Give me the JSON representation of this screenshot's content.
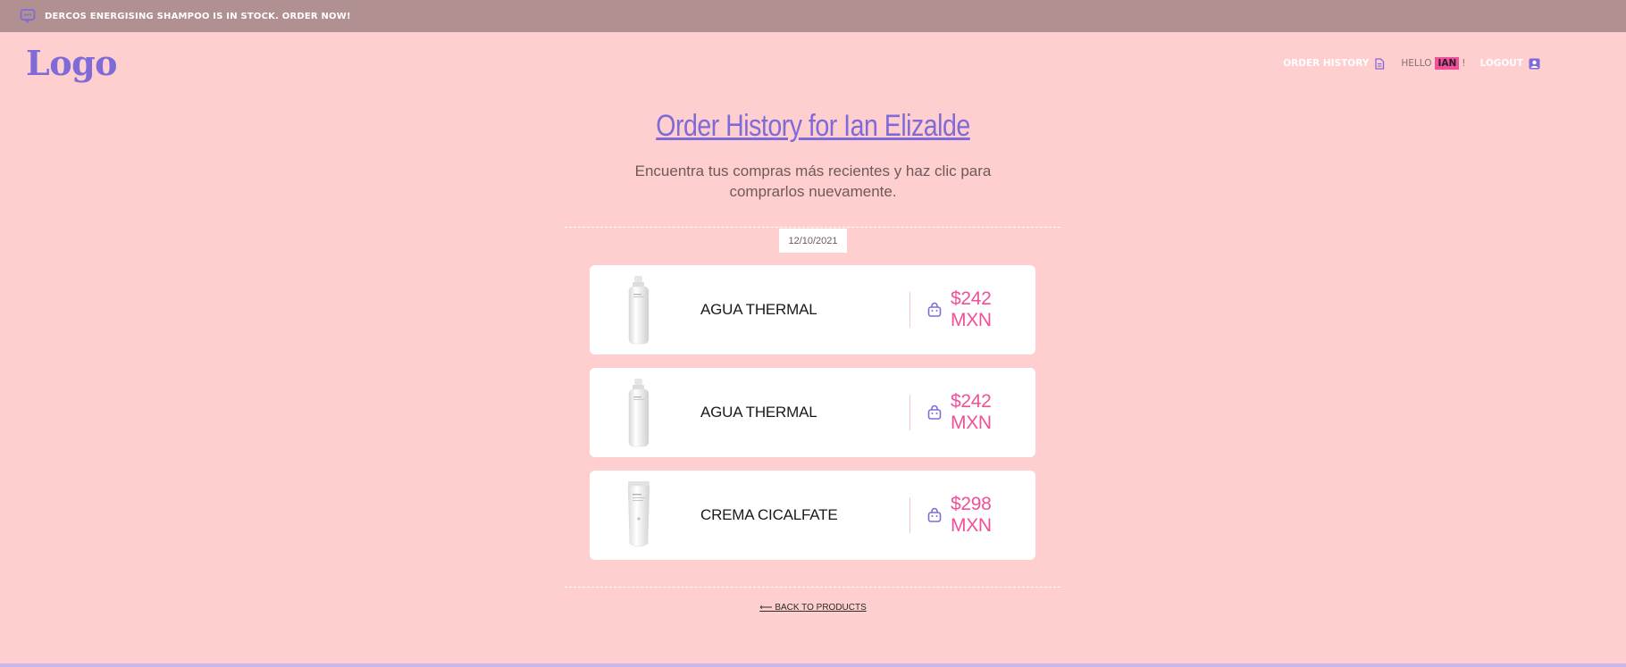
{
  "announcement": {
    "icon": "chat-icon",
    "text": "Dercos energising shampoo is in stock. Order now!"
  },
  "header": {
    "logo": "Logo",
    "nav": {
      "order_history": "Order history",
      "hello_prefix": "Hello",
      "user_name": "Ian",
      "hello_suffix": "!",
      "logout": "Logout"
    }
  },
  "main": {
    "title": "Order History for Ian Elizalde",
    "subtitle": "Encuentra tus compras más recientes y haz clic para comprarlos nuevamente.",
    "date": "12/10/2021",
    "orders": [
      {
        "name": "Agua Thermal",
        "price": "$242 MXN",
        "image": "spray-bottle"
      },
      {
        "name": "Agua Thermal",
        "price": "$242 MXN",
        "image": "spray-bottle"
      },
      {
        "name": "Crema Cicalfate",
        "price": "$298 MXN",
        "image": "cream-tube"
      }
    ],
    "back_link": "⟵ Back to products"
  },
  "colors": {
    "background": "#ffcece",
    "announcement_bar": "#b09090",
    "accent_purple": "#7e6bd8",
    "accent_pink": "#f0509a"
  }
}
